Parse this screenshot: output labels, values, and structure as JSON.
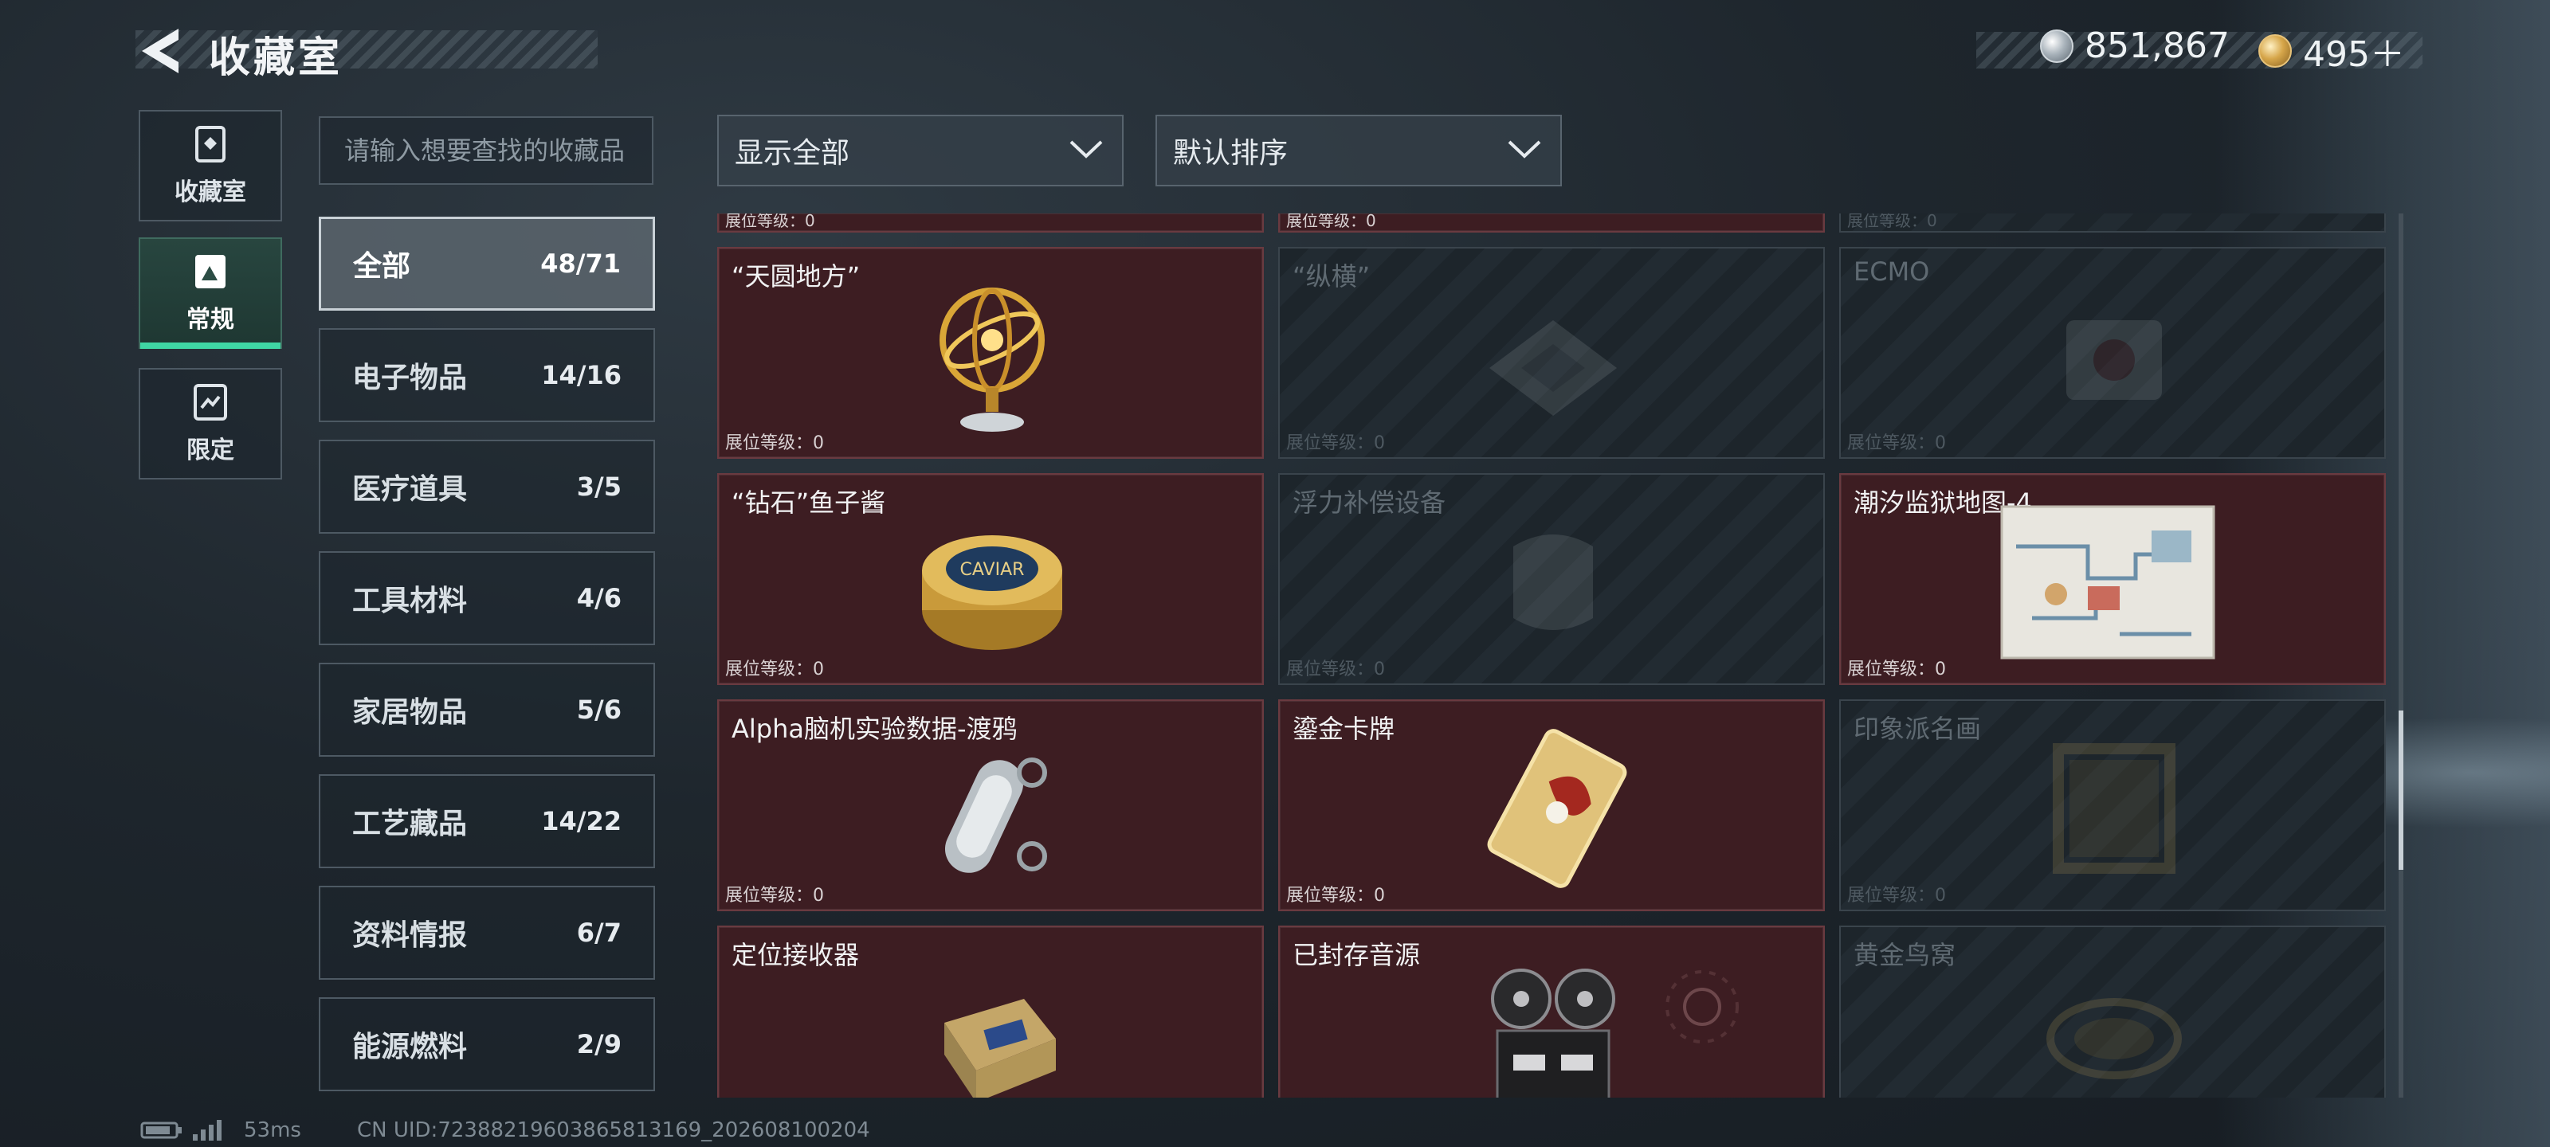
{
  "header": {
    "title": "收藏室",
    "currency_primary": "851,867",
    "currency_secondary": "495＋"
  },
  "nav": [
    {
      "label": "收藏室",
      "icon": "collection-icon"
    },
    {
      "label": "常规",
      "icon": "regular-icon",
      "active": true
    },
    {
      "label": "限定",
      "icon": "limited-icon"
    }
  ],
  "search": {
    "placeholder": "请输入想要查找的收藏品"
  },
  "filters": {
    "show": "显示全部",
    "sort": "默认排序"
  },
  "categories": [
    {
      "name": "全部",
      "count": "48/71",
      "active": true
    },
    {
      "name": "电子物品",
      "count": "14/16"
    },
    {
      "name": "医疗道具",
      "count": "3/5"
    },
    {
      "name": "工具材料",
      "count": "4/6"
    },
    {
      "name": "家居物品",
      "count": "5/6"
    },
    {
      "name": "工艺藏品",
      "count": "14/22"
    },
    {
      "name": "资料情报",
      "count": "6/7"
    },
    {
      "name": "能源燃料",
      "count": "2/9"
    }
  ],
  "level_label": "展位等级：0",
  "items": [
    {
      "title": "“天圆地方”",
      "owned": true,
      "icon": "armillary-sphere-icon"
    },
    {
      "title": "“纵横”",
      "owned": false,
      "icon": "chessboard-icon"
    },
    {
      "title": "ECMO",
      "owned": false,
      "icon": "ecmo-machine-icon"
    },
    {
      "title": "“钻石”鱼子酱",
      "owned": true,
      "icon": "caviar-tin-icon"
    },
    {
      "title": "浮力补偿设备",
      "owned": false,
      "icon": "buoyancy-device-icon"
    },
    {
      "title": "潮汐监狱地图-4",
      "owned": true,
      "icon": "prison-map-icon"
    },
    {
      "title": "Alpha脑机实验数据-渡鸦",
      "owned": true,
      "icon": "data-capsule-icon"
    },
    {
      "title": "鎏金卡牌",
      "owned": true,
      "icon": "gilded-card-icon"
    },
    {
      "title": "印象派名画",
      "owned": false,
      "icon": "painting-icon"
    },
    {
      "title": "定位接收器",
      "owned": true,
      "icon": "gps-receiver-icon"
    },
    {
      "title": "已封存音源",
      "owned": true,
      "icon": "reel-recorder-icon"
    },
    {
      "title": "黄金鸟窝",
      "owned": false,
      "icon": "golden-nest-icon"
    }
  ],
  "footer": {
    "ping": "53ms",
    "uid": "CN UID:7238821960386581316​9_202608100204"
  }
}
